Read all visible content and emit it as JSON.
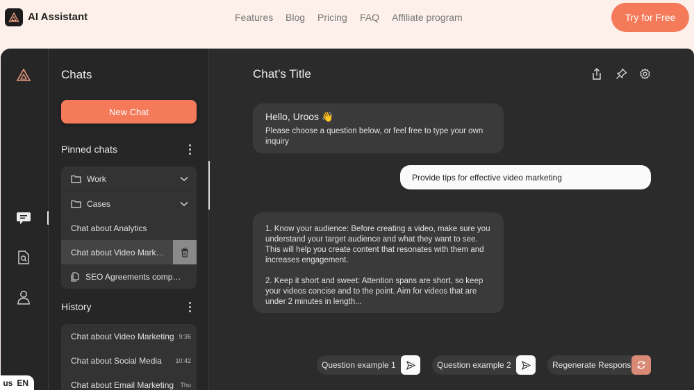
{
  "topbar": {
    "brand": "AI Assistant",
    "nav": [
      "Features",
      "Blog",
      "Pricing",
      "FAQ",
      "Affiliate program"
    ],
    "cta": "Try for Free",
    "lang_prefix": "us",
    "lang": "EN"
  },
  "rail": {
    "icons": [
      "logo-icon",
      "chat-icon",
      "document-search-icon",
      "user-icon"
    ]
  },
  "sidebar": {
    "title": "Chats",
    "new_chat": "New Chat",
    "pinned_title": "Pinned chats",
    "pinned": [
      {
        "label": "Work",
        "type": "folder"
      },
      {
        "label": "Cases",
        "type": "folder"
      },
      {
        "label": "Chat about Analytics",
        "type": "chat"
      },
      {
        "label": "Chat about Video Marketing",
        "type": "chat",
        "active": true
      },
      {
        "label": "SEO Agreements comparison",
        "type": "doc"
      }
    ],
    "history_title": "History",
    "history": [
      {
        "label": "Chat about Video Marketing",
        "time": "9:36"
      },
      {
        "label": "Chat about Social Media",
        "time": "10:42"
      },
      {
        "label": "Chat about Email Marketing",
        "time": "Thu"
      }
    ]
  },
  "main": {
    "title": "Chat’s Title",
    "greeting": {
      "title": "Hello, Uroos 👋",
      "text": "Please choose a question below, or feel free to type your own inquiry"
    },
    "user_message": "Provide tips for effective video marketing",
    "answer": {
      "p1": "1. Know your audience: Before creating a video, make sure you understand your target audience and what they want to see. This will help you create content that resonates with them and increases engagement.",
      "p2": "2. Keep it short and sweet: Attention spans are short, so keep your videos concise and to the point. Aim for videos that are under 2 minutes in length..."
    },
    "quick": {
      "q1": "Question example 1",
      "q2": "Question example 2",
      "regen": "Regenerate Response"
    }
  },
  "colors": {
    "accent": "#f47a5a",
    "panel": "#262626",
    "main_bg": "#2b2b2b",
    "bubble": "#3a3a3a",
    "page_bg": "#fdf0ea"
  }
}
